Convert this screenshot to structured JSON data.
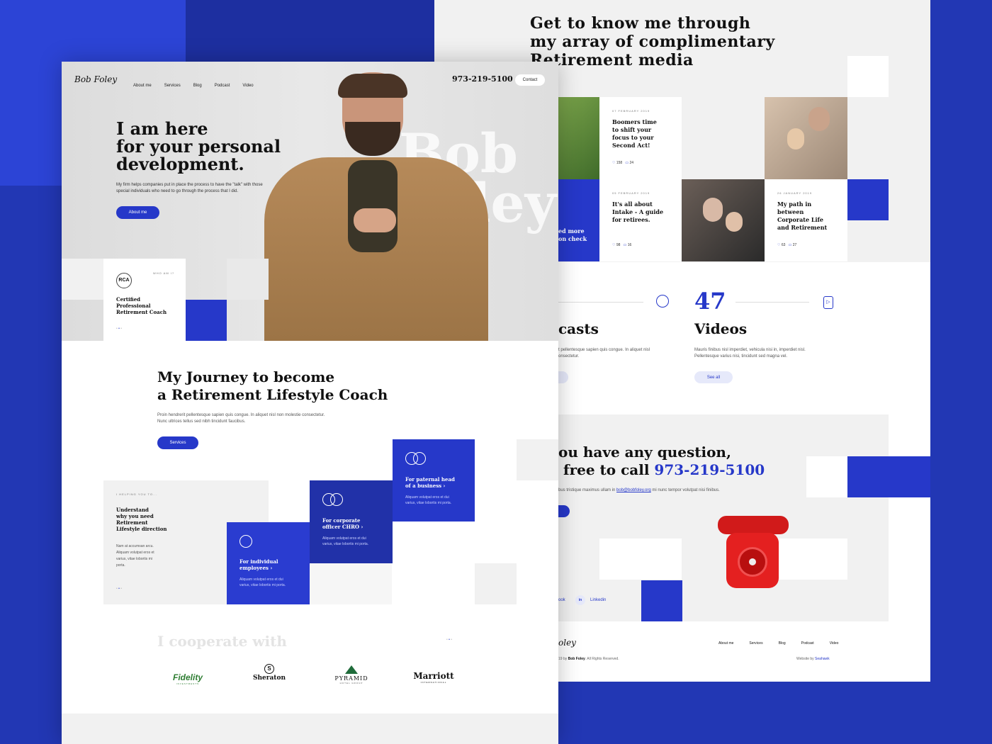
{
  "header": {
    "logo": "Bob Foley",
    "nav": [
      "About me",
      "Services",
      "Blog",
      "Podcast",
      "Video"
    ],
    "phone": "973-219-5100",
    "contact_label": "Contact"
  },
  "hero": {
    "headline_1": "I am here",
    "headline_2": "for your personal",
    "headline_3": "development.",
    "body_1": "My firm helps companies put in place the process to have the \"talk\" with those",
    "body_2": "special individuals who need to go through the process that I did.",
    "cta": "About me",
    "watermark_1": "Bob",
    "watermark_2": "Foley",
    "who_am_i": "WHO AM I?",
    "badge": "RCA",
    "cert_1": "Certified",
    "cert_2": "Professional",
    "cert_3": "Retirement Coach"
  },
  "journey": {
    "title_1": "My Journey to become",
    "title_2": "a Retirement Lifestyle Coach",
    "body_1": "Proin hendrerit pellentesque sapien quis congue. In aliquet nisl non molestie consectetur.",
    "body_2": "Nunc ultrices tellus sed nibh tincidunt faucibus.",
    "cta": "Services",
    "helping": "I HELPING YOU TO...",
    "help_1": "Understand",
    "help_2": "why you need",
    "help_3": "Retirement",
    "help_4": "Lifestyle direction",
    "help_body_1": "Nam at accumsan arcu.",
    "help_body_2": "Aliquam volutpat eros et",
    "help_body_3": "varius, vitae lobortis mi",
    "help_body_4": "porta.",
    "cards": [
      {
        "title_1": "For individual",
        "title_2": "employees",
        "body_1": "Aliquam volutpat eros et dui",
        "body_2": "varius, vitae lobortis mi porta."
      },
      {
        "title_1": "For corporate",
        "title_2": "officer CHRO",
        "body_1": "Aliquam volutpat eros et dui",
        "body_2": "varius, vitae lobortis mi porta."
      },
      {
        "title_1": "For paternal head",
        "title_2": "of a business",
        "body_1": "Aliquam volutpat eros et dui",
        "body_2": "varius, vitae lobortis mi porta."
      }
    ]
  },
  "cooperate": {
    "title": "I cooperate with",
    "logos": [
      "Fidelity",
      "Sheraton",
      "PYRAMID",
      "Marriott"
    ],
    "logo_subs": [
      "INVESTMENTS",
      "",
      "HOTEL GROUP",
      "INTERNATIONAL"
    ]
  },
  "media": {
    "title_1": "Get to know me through",
    "title_2": "my array of complimentary",
    "title_3": "Retirement media",
    "posts": [
      {
        "date": "07 FEBRUARY 2019",
        "t1": "Boomers time",
        "t2": "to shift your",
        "t3": "focus to your",
        "t4": "Second Act!",
        "likes": "158",
        "comments": "24"
      },
      {
        "date": "05 FEBRUARY 2019",
        "t1": "It's all about",
        "t2": "Intake -  A guide",
        "t3": "for retirees.",
        "t4": "",
        "likes": "98",
        "comments": "16"
      },
      {
        "date": "26 JANUARY 2019",
        "t1": "My path in",
        "t2": "between",
        "t3": "Corporate Life",
        "t4": "and Retirement",
        "likes": "63",
        "comments": "27"
      }
    ],
    "read_more_1": "ed more",
    "read_more_2": "on check"
  },
  "stats": {
    "podcasts_label": "casts",
    "podcasts_body_1": "t pellentesque sapien quis congue. In aliquet nisl",
    "podcasts_body_2": "onsectetur.",
    "videos_count": "47",
    "videos_label": "Videos",
    "videos_body_1": "Mauris finibus nisl imperdiet, vehicula nisi in, imperdiet nisl.",
    "videos_body_2": "Pellentesque varius nisi, tincidunt sed magna vel.",
    "see_all": "See all"
  },
  "question": {
    "line_1": "ou have any question,",
    "line_2_prefix": "free to call",
    "phone": "973-219-5100",
    "body_prefix": "bus tristique maximus ullam in",
    "email": "bob@bobfoley.org",
    "body_suffix": "mi nunc tempor volutpat nisi finibus."
  },
  "social": {
    "facebook_partial": "ook",
    "linkedin_icon": "in",
    "linkedin": "Linkedin"
  },
  "footer": {
    "logo_partial": "oley",
    "copyright_prefix": "19 by",
    "copyright_name": "Bob Foley",
    "copyright_suffix": ". All Rights Reserved.",
    "nav": [
      "About me",
      "Services",
      "Blog",
      "Podcast",
      "Video"
    ],
    "website_by": "Website by",
    "agency": "Seahawk"
  },
  "colors": {
    "accent": "#2638c9",
    "bg": "#2237b4",
    "light": "#f1f1f1"
  }
}
